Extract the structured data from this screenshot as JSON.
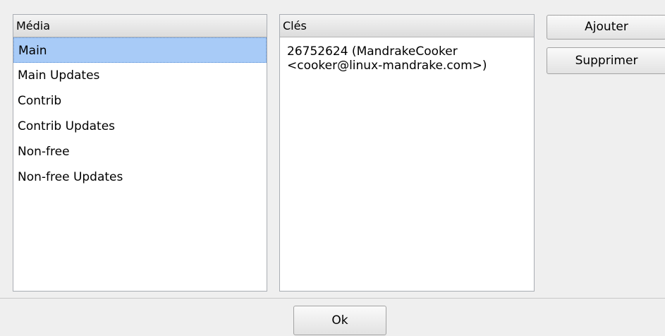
{
  "media_panel": {
    "header": "Média",
    "items": [
      {
        "label": "Main",
        "selected": true
      },
      {
        "label": "Main Updates",
        "selected": false
      },
      {
        "label": "Contrib",
        "selected": false
      },
      {
        "label": "Contrib Updates",
        "selected": false
      },
      {
        "label": "Non-free",
        "selected": false
      },
      {
        "label": "Non-free Updates",
        "selected": false
      }
    ]
  },
  "keys_panel": {
    "header": "Clés",
    "items": [
      {
        "label": "26752624 (MandrakeCooker <cooker@linux-mandrake.com>)"
      }
    ]
  },
  "buttons": {
    "add_label": "Ajouter",
    "remove_label": "Supprimer",
    "ok_label": "Ok"
  },
  "colors": {
    "selection": "#a8cbf7",
    "window_bg": "#efefef"
  }
}
